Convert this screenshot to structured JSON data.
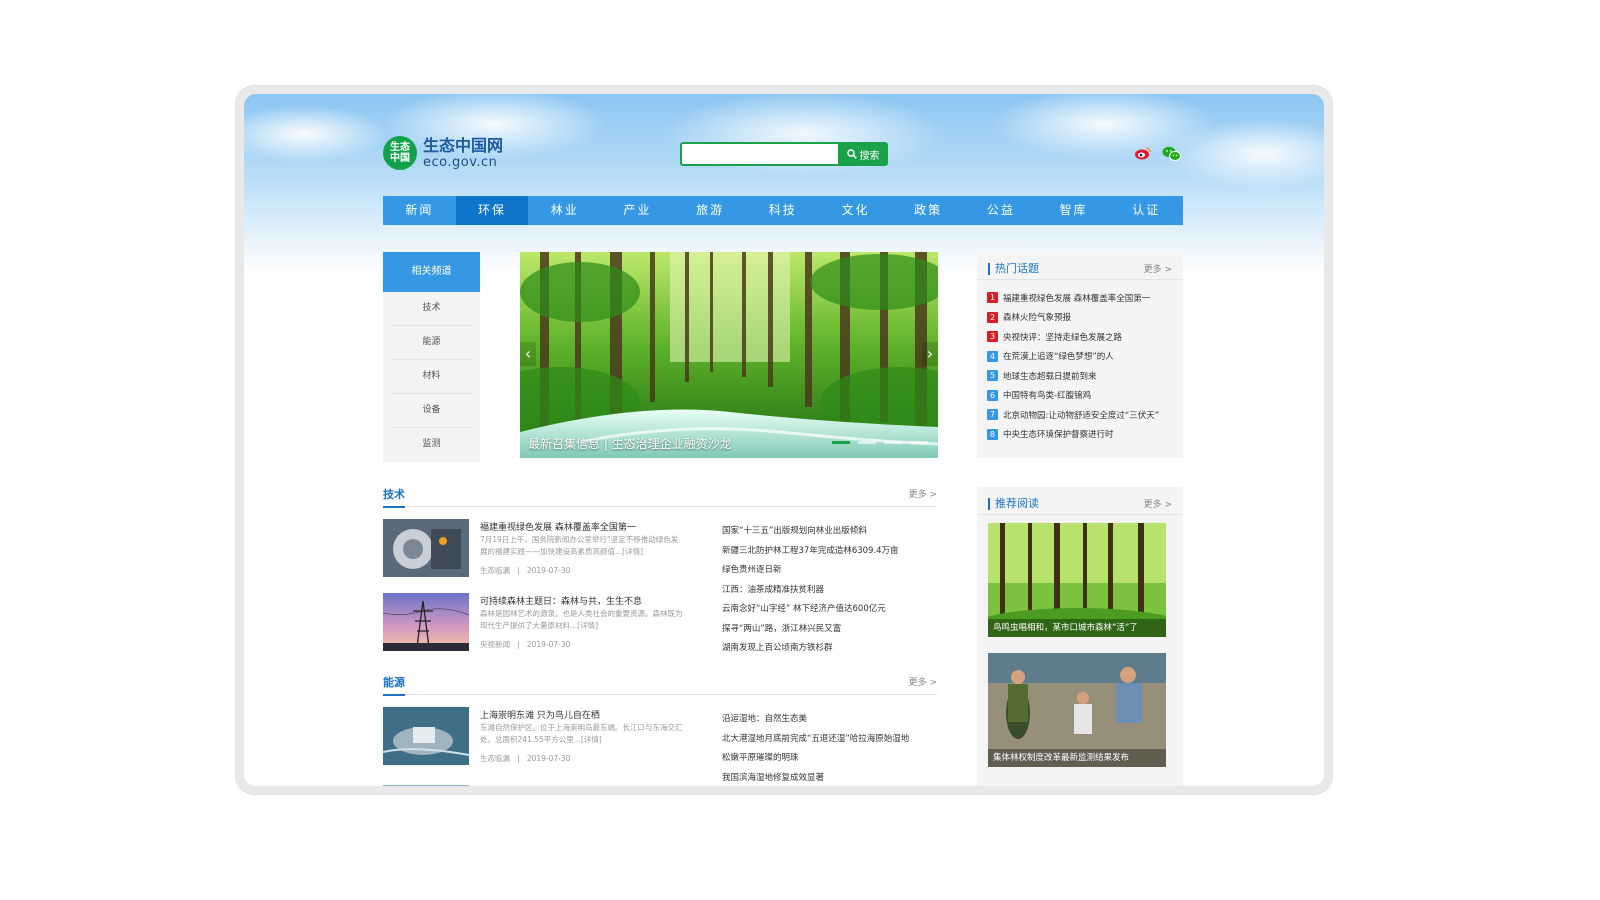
{
  "logo": {
    "badge_line1": "生态",
    "badge_line2": "中国",
    "name": "生态中国网",
    "domain": "eco.gov.cn"
  },
  "search": {
    "value": "",
    "button_label": "搜索"
  },
  "nav": [
    "新闻",
    "环保",
    "林业",
    "产业",
    "旅游",
    "科技",
    "文化",
    "政策",
    "公益",
    "智库",
    "认证"
  ],
  "nav_active": "环保",
  "sidebar": {
    "title": "相关频道",
    "items": [
      "技术",
      "能源",
      "材料",
      "设备",
      "监测"
    ]
  },
  "banner": {
    "caption": "最新召集信息 | 生态治理企业融资沙龙",
    "prev": "‹",
    "next": "›"
  },
  "hot": {
    "title": "热门话题",
    "more": "更多 >",
    "items": [
      {
        "rank": "1",
        "text": "福建重视绿色发展 森林覆盖率全国第一"
      },
      {
        "rank": "2",
        "text": "森林火险气象预报"
      },
      {
        "rank": "3",
        "text": "央视快评：坚持走绿色发展之路"
      },
      {
        "rank": "4",
        "text": "在荒漠上追逐“绿色梦想”的人"
      },
      {
        "rank": "5",
        "text": "地球生态超载日提前到来"
      },
      {
        "rank": "6",
        "text": "中国特有鸟类-红腹锦鸡"
      },
      {
        "rank": "7",
        "text": "北京动物园:让动物舒适安全度过“三伏天”"
      },
      {
        "rank": "8",
        "text": "中央生态环境保护督察进行时"
      }
    ],
    "colors": {
      "top": "#d81e27",
      "rest": "#3598e4"
    }
  },
  "recommend": {
    "title": "推荐阅读",
    "more": "更多 >",
    "items": [
      {
        "caption": "鸟鸣虫唱相和，某市口城市森林“活”了"
      },
      {
        "caption": "集体林权制度改革最新监测结果发布"
      }
    ]
  },
  "sections": [
    {
      "title": "技术",
      "more": "更多 >",
      "articles": [
        {
          "title": "福建重视绿色发展 森林覆盖率全国第一",
          "summary": "7月19日上午，国务院新闻办公室举行“坚定不移推动绿色发展的福建实践——加快建设高素质高颜值...[详情]",
          "source": "生态临漏",
          "sep": "|",
          "date": "2019-07-30"
        },
        {
          "title": "可持续森林主题日：森林与共，生生不息",
          "summary": "森林是园林艺术的源泉。也是人类社会的重要资源。森林既为现代生产提供了大量原材料...[详情]",
          "source": "央视新闻",
          "sep": "|",
          "date": "2019-07-30"
        }
      ],
      "links": [
        "国家“十三五”出版规划向林业出版倾斜",
        "新疆三北防护林工程37年完成造林6309.4万亩",
        "绿色贵州逐日新",
        "江西：油茶成精准扶贫利器",
        "云南念好“山字经” 林下经济产值达600亿元",
        "探寻“两山”路，浙江林兴民又富",
        "湖南发现上百公顷南方铁杉群"
      ]
    },
    {
      "title": "能源",
      "more": "更多 >",
      "articles": [
        {
          "title": "上海崇明东滩 只为鸟儿自在栖",
          "summary": "东滩自然保护区。位于上海崇明岛最东端。长江口与东海交汇处。总面积241.55平方公里...[详情]",
          "source": "生态临漏",
          "sep": "|",
          "date": "2019-07-30"
        }
      ],
      "links": [
        "沿运湿地：自然生态美",
        "北大港湿地月底前完成“五退还湿”哈拉海原始湿地",
        "松嫩平原璀璨的明珠",
        "我国滨海湿地修复成效显著"
      ]
    }
  ]
}
